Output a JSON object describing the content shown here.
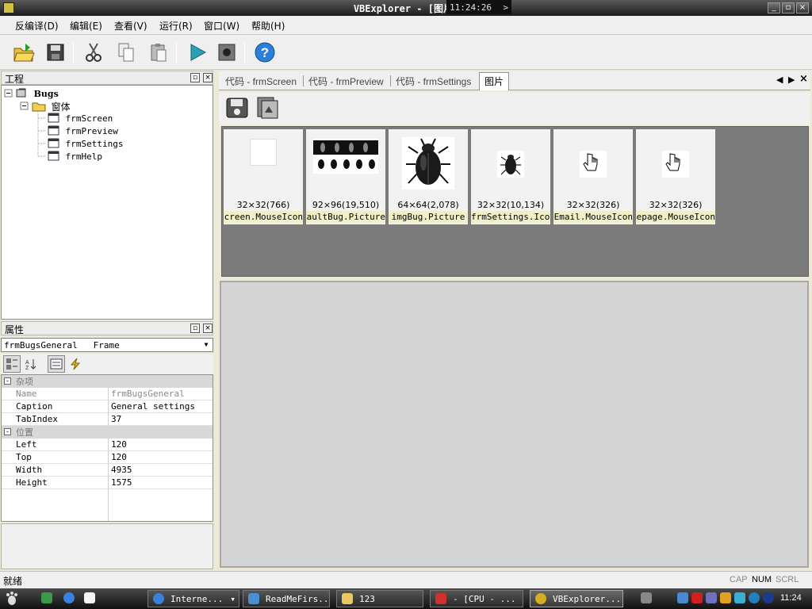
{
  "window": {
    "title": "VBExplorer - [图片]",
    "clock": "11:24:26",
    "clock_glyph": ">"
  },
  "menu": [
    {
      "label": "反编译(D)"
    },
    {
      "label": "编辑(E)"
    },
    {
      "label": "查看(V)"
    },
    {
      "label": "运行(R)"
    },
    {
      "label": "窗口(W)"
    },
    {
      "label": "帮助(H)"
    }
  ],
  "toolbar": {
    "buttons": [
      "open-folder-icon",
      "save-icon",
      "cut-icon",
      "copy-icon",
      "paste-icon",
      "run-icon",
      "stop-icon",
      "help-icon"
    ]
  },
  "project_pane": {
    "title": "工程",
    "tree": {
      "root": "Bugs",
      "folder": "窗体",
      "forms": [
        "frmScreen",
        "frmPreview",
        "frmSettings",
        "frmHelp"
      ]
    }
  },
  "properties_pane": {
    "title": "属性",
    "object": "frmBugsGeneral",
    "object_type": "Frame",
    "categories": [
      {
        "name": "杂项",
        "rows": [
          {
            "key": "Name",
            "value": "frmBugsGeneral",
            "dim": true
          },
          {
            "key": "Caption",
            "value": "General settings"
          },
          {
            "key": "TabIndex",
            "value": "37"
          }
        ]
      },
      {
        "name": "位置",
        "rows": [
          {
            "key": "Left",
            "value": "120"
          },
          {
            "key": "Top",
            "value": "120"
          },
          {
            "key": "Width",
            "value": "4935"
          },
          {
            "key": "Height",
            "value": "1575"
          }
        ]
      }
    ]
  },
  "tabs": [
    {
      "label": "代码 - frmScreen"
    },
    {
      "label": "代码 - frmPreview"
    },
    {
      "label": "代码 - frmSettings"
    },
    {
      "label": "图片",
      "active": true
    }
  ],
  "images": [
    {
      "size": "32×32(766)",
      "name": "frmScreen.MouseIcon",
      "kind": "blank"
    },
    {
      "size": "92×96(19,510)",
      "name": "picDefaultBug.Picture",
      "kind": "bugstrip"
    },
    {
      "size": "64×64(2,078)",
      "name": "imgBug.Picture",
      "kind": "bug"
    },
    {
      "size": "32×32(10,134)",
      "name": "frmSettings.Icon",
      "kind": "smallbug"
    },
    {
      "size": "32×32(326)",
      "name": "txtEmail.MouseIcon",
      "kind": "hand"
    },
    {
      "size": "32×32(326)",
      "name": "txtHomepage.MouseIcon",
      "kind": "hand"
    }
  ],
  "status": {
    "text": "就绪",
    "cap": "CAP",
    "num": "NUM",
    "scrl": "SCRL"
  },
  "taskbar": {
    "items": [
      {
        "label": "Interne...",
        "color": "#3a7fd8",
        "arrow": "▾"
      },
      {
        "label": "ReadMeFirs...",
        "color": "#4a90d0"
      },
      {
        "label": "123",
        "color": "#e8c860"
      },
      {
        "label": "- [CPU - ...",
        "color": "#d03030"
      },
      {
        "label": "VBExplorer...",
        "color": "#d4b020",
        "active": true
      }
    ],
    "clock": "11:24"
  }
}
